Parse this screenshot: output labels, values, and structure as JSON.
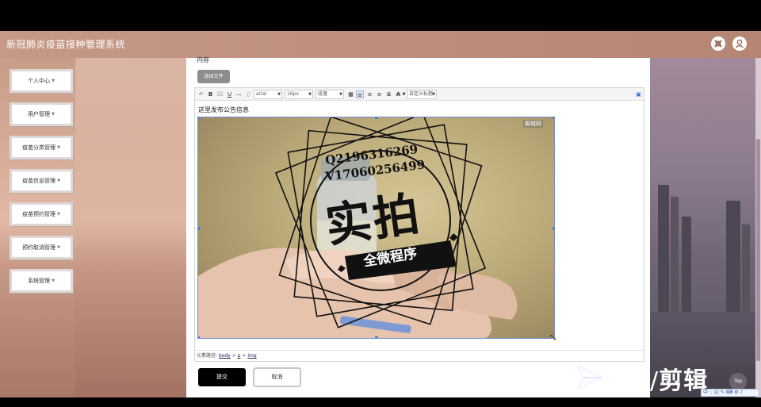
{
  "app": {
    "title": "新冠肺炎疫苗接种管理系统",
    "header_icons": [
      "fullscreen-icon",
      "user-icon"
    ]
  },
  "sidebar": {
    "items": [
      {
        "label": "个人中心"
      },
      {
        "label": "用户管理"
      },
      {
        "label": "疫苗分类管理"
      },
      {
        "label": "疫苗信息管理"
      },
      {
        "label": "疫苗预约管理"
      },
      {
        "label": "预约取消管理"
      },
      {
        "label": "系统管理"
      }
    ]
  },
  "form": {
    "field_label_cut": "内容",
    "choose_file": "选择文件",
    "toolbar": {
      "font_family": "arial",
      "font_size": "16px",
      "alignment": "段落",
      "custom_title": "自定义标题",
      "bold": "B",
      "underline": "U",
      "font_color": "A"
    },
    "content_text": "这里发布公告信息",
    "image": {
      "corner_tag": "脚城网",
      "stamp_line1": "Q2196316269",
      "stamp_line2": "V17060256499",
      "stamp_big": "实拍",
      "stamp_ribbon": "全微程序"
    },
    "element_path": {
      "label": "元素路径:",
      "parts": [
        "body",
        "p",
        "img"
      ],
      "separator": ">"
    },
    "submit_label": "提交",
    "cancel_label": "取消"
  },
  "overlay": {
    "watermark": "剪辑",
    "top_button": "Top",
    "ime_text": "中 ·, ☺ ✎ ⌨ ⚙ ♪"
  },
  "colors": {
    "header": "#be8e7c",
    "accent": "#000000"
  }
}
